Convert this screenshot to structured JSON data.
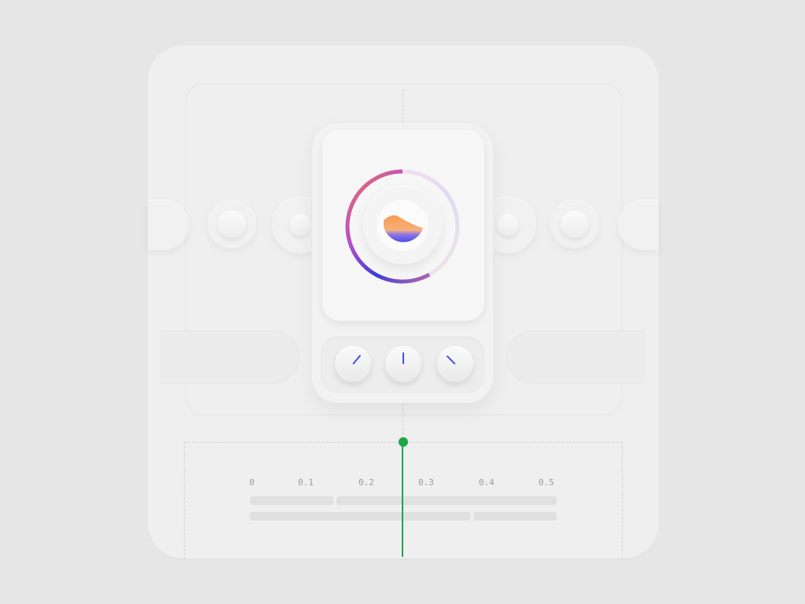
{
  "timeline": {
    "scale_labels": [
      "0",
      "0.1",
      "0.2",
      "0.3",
      "0.4",
      "0.5"
    ],
    "playhead_value": 0.26
  },
  "dials": [
    {
      "name": "dial-left",
      "angle_deg": 40
    },
    {
      "name": "dial-center",
      "angle_deg": 0
    },
    {
      "name": "dial-right",
      "angle_deg": -45
    }
  ],
  "colors": {
    "background": "#e6e6e6",
    "playhead": "#1ea64a",
    "needle": "#3f52e3",
    "ring_start": "#f0705a",
    "ring_end": "#3a3fd8",
    "logo_orange": "#f6a25a",
    "logo_violet": "#5a55e6"
  },
  "icons": {
    "logo": "gradient-half-circle-icon",
    "ring": "gradient-progress-ring"
  }
}
